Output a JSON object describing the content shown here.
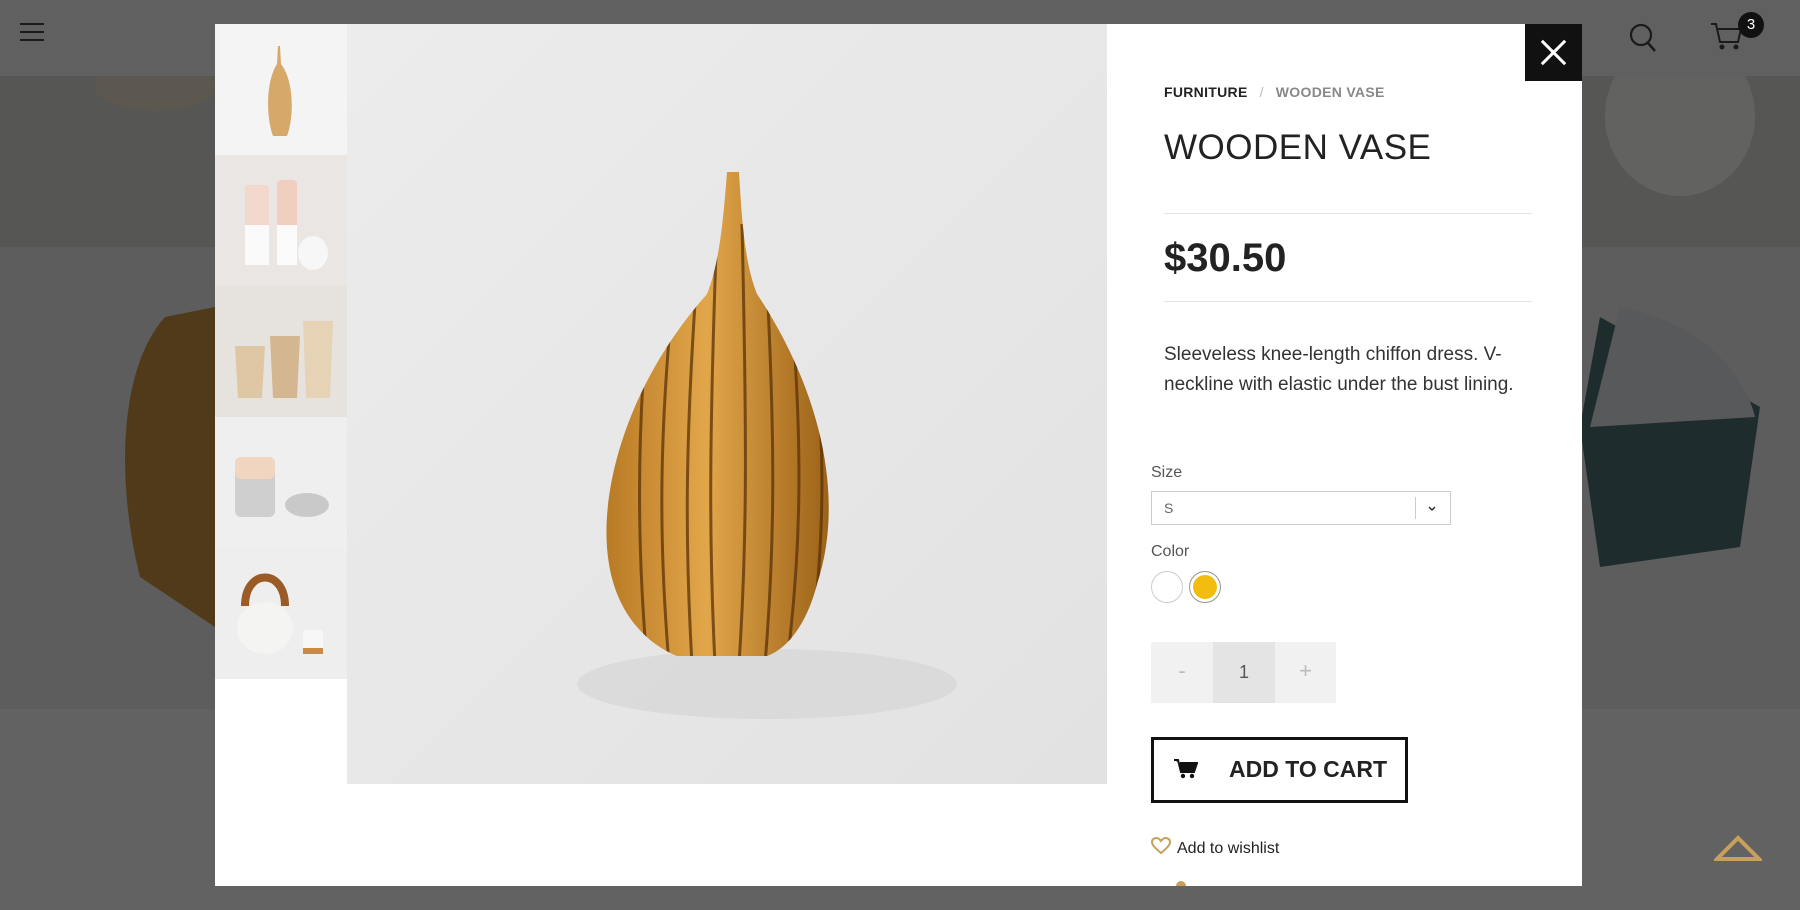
{
  "header": {
    "cart_count": "3"
  },
  "breadcrumb": {
    "category": "FURNITURE",
    "separator": "/",
    "current": "WOODEN VASE"
  },
  "product": {
    "title": "WOODEN VASE",
    "price": "$30.50",
    "description": "Sleeveless knee-length chiffon dress. V-neckline with elastic under the bust lining."
  },
  "options": {
    "size_label": "Size",
    "size_selected": "S",
    "color_label": "Color",
    "colors": [
      {
        "name": "white",
        "hex": "#ffffff"
      },
      {
        "name": "yellow",
        "hex": "#f2bd0f",
        "selected": true
      }
    ]
  },
  "quantity": {
    "minus": "-",
    "value": "1",
    "plus": "+"
  },
  "actions": {
    "add_to_cart": "ADD TO CART",
    "wishlist": "Add to wishlist"
  },
  "thumbnails": [
    "wooden-vase",
    "white-ombre-vases",
    "wooden-cups",
    "ceramic-pitcher-set",
    "teapot-set"
  ],
  "colors": {
    "accent_gold": "#c9a05a",
    "dark": "#111111"
  }
}
